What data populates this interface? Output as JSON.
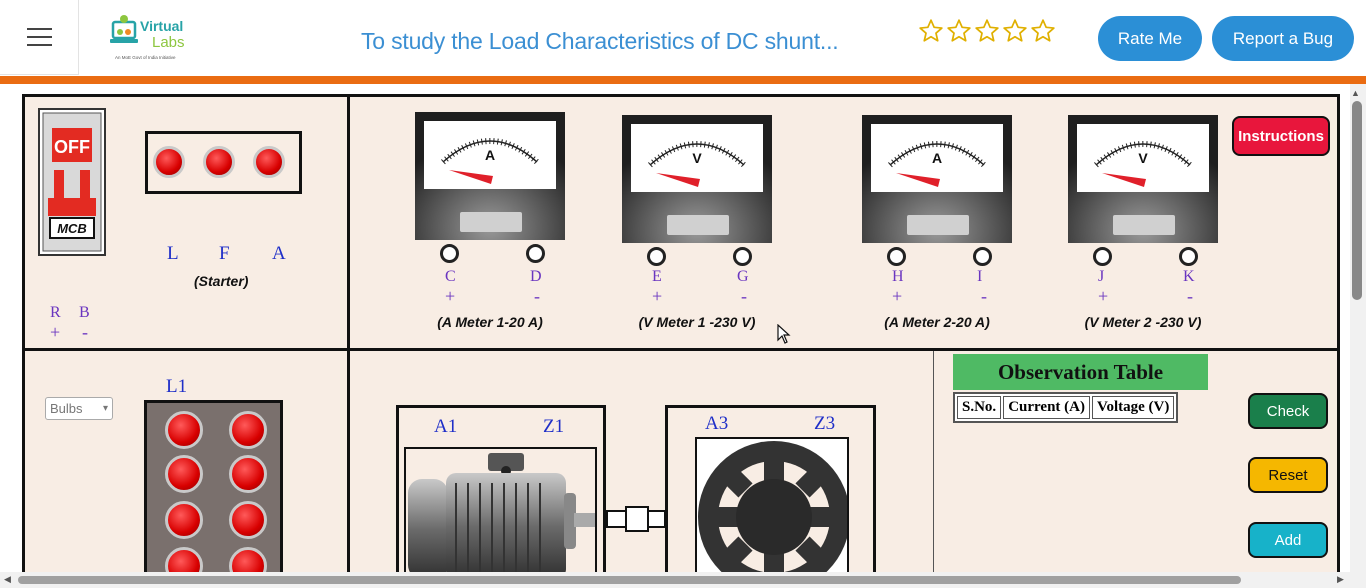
{
  "header": {
    "title": "To study the Load Characteristics of DC shunt...",
    "rating_stars": 5,
    "rate_label": "Rate Me",
    "bug_label": "Report a Bug",
    "logo_text_1": "Virtual",
    "logo_text_2": "Labs",
    "logo_tagline": "An MoE Govt of India Initiative",
    "accent_color": "#2b8fd6",
    "bar_color": "#ea6c12"
  },
  "mcb": {
    "off_label": "OFF",
    "mcb_label": "MCB"
  },
  "starter": {
    "l": "L",
    "f": "F",
    "a": "A",
    "caption": "(Starter)"
  },
  "supply": {
    "r": "R",
    "b": "B",
    "r_sign": "+",
    "b_sign": "-"
  },
  "meters": [
    {
      "symbol": "A",
      "t1": "C",
      "t2": "D",
      "caption": "(A Meter 1-20 A)"
    },
    {
      "symbol": "V",
      "t1": "E",
      "t2": "G",
      "caption": "(V Meter 1 -230 V)"
    },
    {
      "symbol": "A",
      "t1": "H",
      "t2": "I",
      "caption": "(A Meter 2-20 A)"
    },
    {
      "symbol": "V",
      "t1": "J",
      "t2": "K",
      "caption": "(V Meter 2 -230 V)"
    }
  ],
  "meter_signs": {
    "plus": "+",
    "minus": "-"
  },
  "instructions_label": "Instructions",
  "load": {
    "select_value": "Bulbs",
    "label": "L1"
  },
  "motor": {
    "a": "A1",
    "z": "Z1"
  },
  "generator": {
    "a": "A3",
    "z": "Z3"
  },
  "observation": {
    "title": "Observation Table",
    "columns": [
      "S.No.",
      "Current (A)",
      "Voltage (V)"
    ]
  },
  "buttons": {
    "check": "Check",
    "reset": "Reset",
    "add": "Add"
  },
  "colors": {
    "check": "#1a7f4b",
    "reset": "#f5b700",
    "add": "#17b2c9",
    "instructions": "#e8163c",
    "board": "#f8ede4"
  }
}
